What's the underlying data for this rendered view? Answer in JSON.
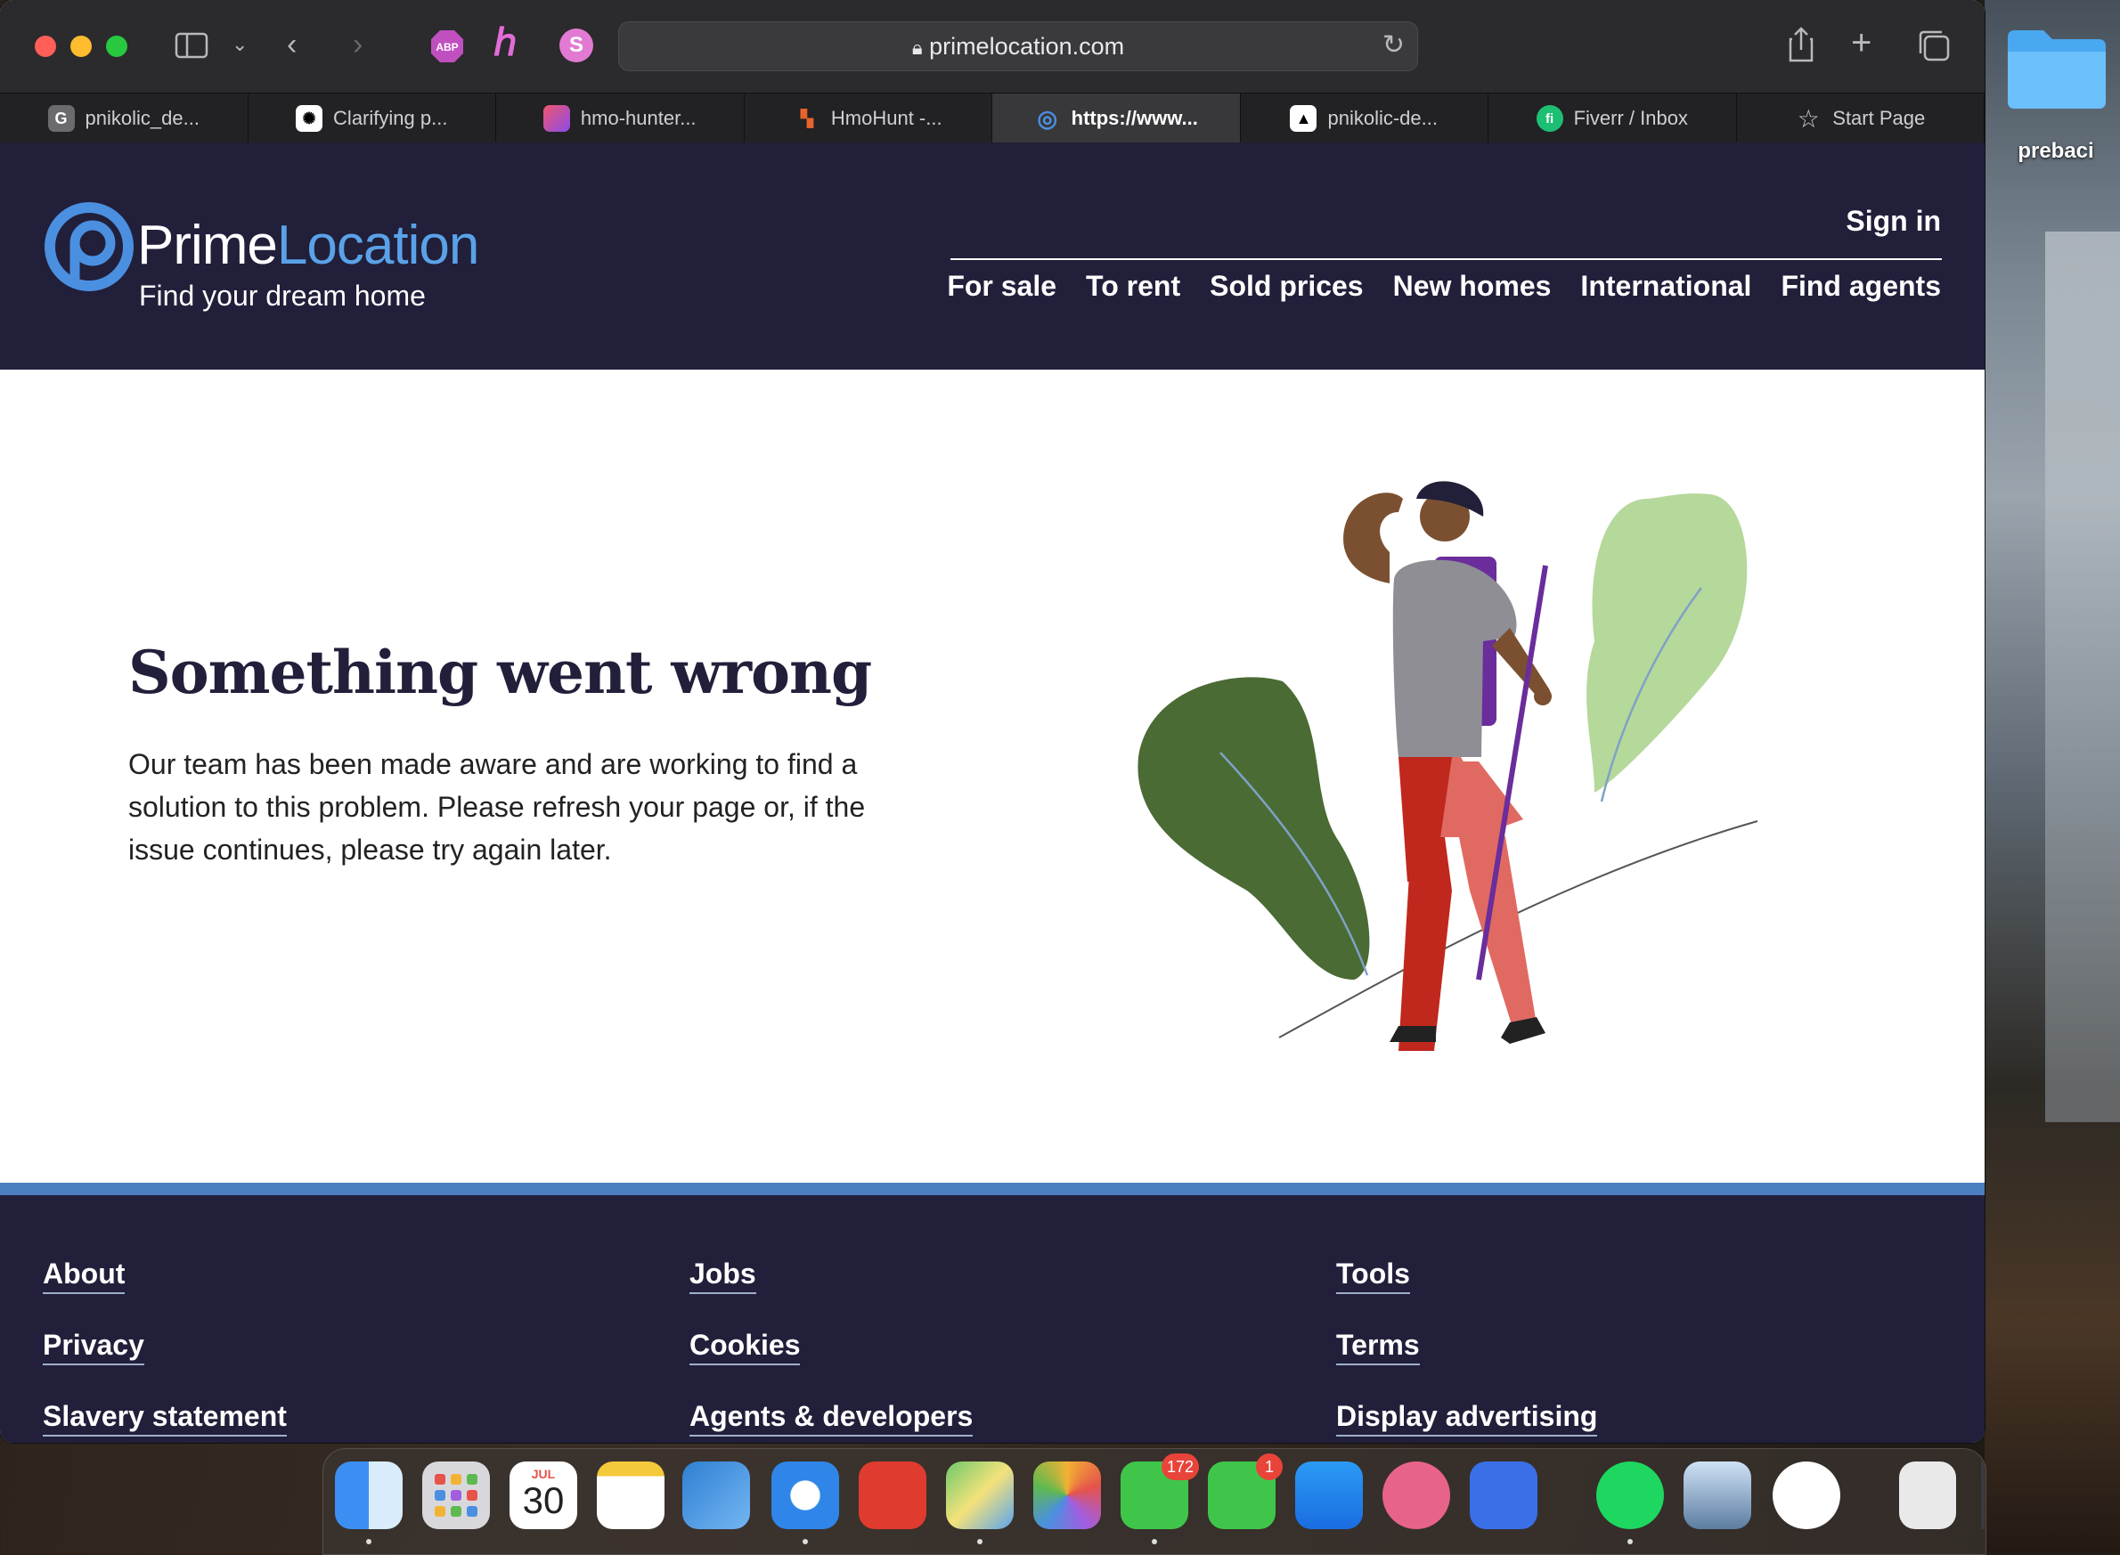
{
  "browser": {
    "address": "primelocation.com",
    "tabs": [
      {
        "label": "pnikolic_de...",
        "icon": "G",
        "color": "#6b6b6e"
      },
      {
        "label": "Clarifying p...",
        "icon": "✺",
        "color": "#ffffff"
      },
      {
        "label": "hmo-hunter...",
        "icon": "◆",
        "color": "#e0478a"
      },
      {
        "label": "HmoHunt -...",
        "icon": "▚",
        "color": "#e6642c"
      },
      {
        "label": "https://www...",
        "icon": "◎",
        "color": "#4b8fe0"
      },
      {
        "label": "pnikolic-de...",
        "icon": "▲",
        "color": "#ffffff"
      },
      {
        "label": "Fiverr / Inbox",
        "icon": "fi",
        "color": "#1dbf73"
      },
      {
        "label": "Start Page",
        "icon": "☆",
        "color": "transparent"
      }
    ],
    "extensions": {
      "abp": "ABP",
      "h": "ℎ",
      "s": "S"
    }
  },
  "desktop": {
    "folder_label": "prebaci"
  },
  "site": {
    "brand_prime": "Prime",
    "brand_location": "Location",
    "tagline": "Find your dream home",
    "sign_in": "Sign in",
    "nav": [
      "For sale",
      "To rent",
      "Sold prices",
      "New homes",
      "International",
      "Find agents"
    ]
  },
  "error": {
    "title": "Something went wrong",
    "body": "Our team has been made aware and are working to find a solution to this problem. Please refresh your page or, if the issue continues, please try again later."
  },
  "footer": {
    "col1": [
      "About",
      "Privacy",
      "Slavery statement"
    ],
    "col2": [
      "Jobs",
      "Cookies",
      "Agents & developers"
    ],
    "col3": [
      "Tools",
      "Terms",
      "Display advertising"
    ]
  },
  "dock": {
    "calendar_month": "JUL",
    "calendar_day": "30",
    "messages_badge": "172",
    "facetime_badge": "1"
  },
  "colors": {
    "header_bg": "#211f3a",
    "accent_blue": "#4b7fbf",
    "logo_blue": "#5aa2e8"
  }
}
